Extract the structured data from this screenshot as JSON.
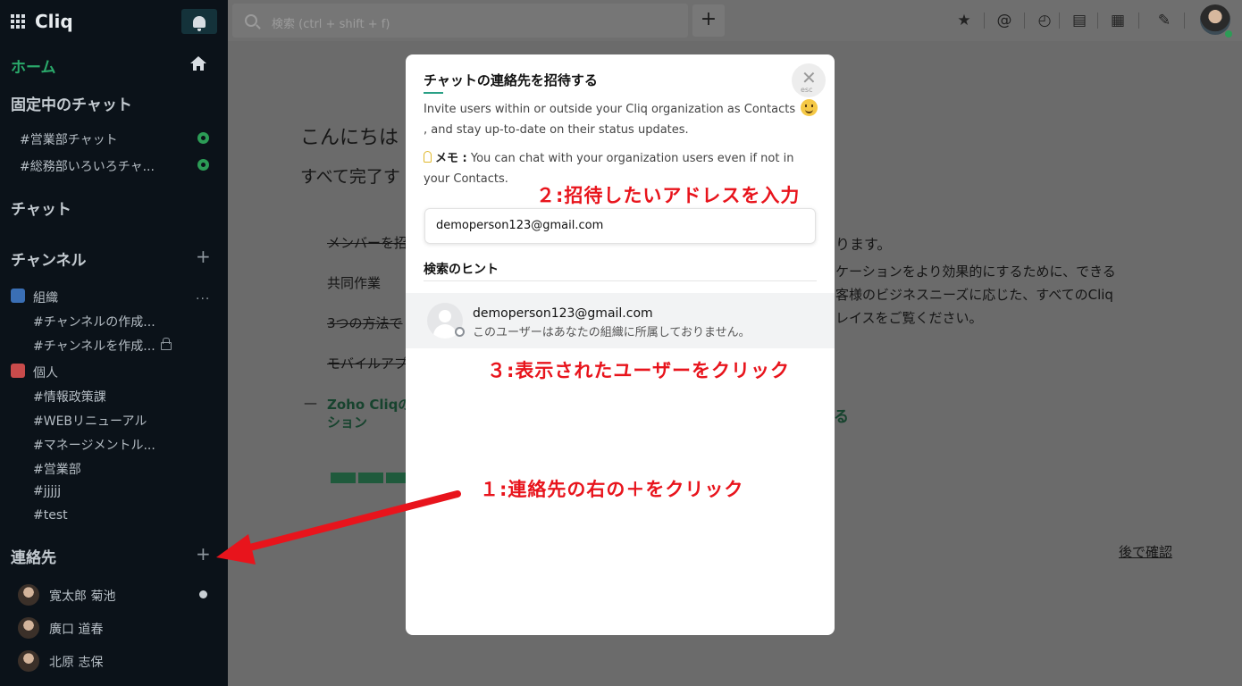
{
  "app": {
    "name": "Cliq"
  },
  "sidebar": {
    "home_label": "ホーム",
    "pinned_title": "固定中のチャット",
    "pinned": [
      "#営業部チャット",
      "#総務部いろいろチャ..."
    ],
    "chat_title": "チャット",
    "channels_title": "チャンネル",
    "org_group": "組織",
    "org_channels": [
      "#チャンネルの作成...",
      "#チャンネルを作成..."
    ],
    "personal_group": "個人",
    "personal_channels": [
      "#情報政策課",
      "#WEBリニューアル",
      "#マネージメントル...",
      "#営業部",
      "#jjjjj",
      "#test"
    ],
    "contacts_title": "連絡先",
    "contacts": [
      "寛太郎 菊池",
      "廣口 道春",
      "北原 志保"
    ],
    "plus": "+",
    "more": "..."
  },
  "topbar": {
    "search_placeholder": "検索 (ctrl + shift + f)",
    "new_label": "+",
    "icons": [
      "star-icon",
      "at-icon",
      "history-icon",
      "files-icon",
      "calendar-icon",
      "pin-icon"
    ]
  },
  "main": {
    "greeting": "こんにちは",
    "done": "すべて完了す",
    "step1": "メンバーを招",
    "step2": "共同作業",
    "step3": "3つの方法で",
    "step4": "モバイルアプ",
    "dash": "—",
    "link1": "Zoho Cliqの",
    "link2": "ション",
    "right1": "ります。",
    "right2": "ケーションをより効果的にするために、できる",
    "right3": "客様のビジネスニーズに応じた、すべてのCliq",
    "right4": "レイスをご覧ください。",
    "right_link": "る",
    "later": "後で確認"
  },
  "modal": {
    "title": "チャットの連絡先を招待する",
    "close_symbol": "✕",
    "close_hint": "esc",
    "desc_pre": "Invite users within or outside your Cliq organization as Contacts",
    "desc_post": ", and stay up-to-date on their status updates.",
    "memo_label": "メモ :",
    "memo_text": " You can chat with your organization users even if not in your Contacts.",
    "input_value": "demoperson123@gmail.com",
    "hint_title": "検索のヒント",
    "result_email": "demoperson123@gmail.com",
    "result_note": "このユーザーはあなたの組織に所属しておりません。"
  },
  "annotations": {
    "step1": "１:連絡先の右の＋をクリック",
    "step2": "２:招待したいアドレスを入力",
    "step3": "３:表示されたユーザーをクリック"
  },
  "colors": {
    "sidebar_bg": "#0b1219",
    "accent_green": "#2aa86a",
    "annotation_red": "#e8141c",
    "overlay_gray": "#6b6b6b",
    "modal_bg": "#ffffff"
  }
}
